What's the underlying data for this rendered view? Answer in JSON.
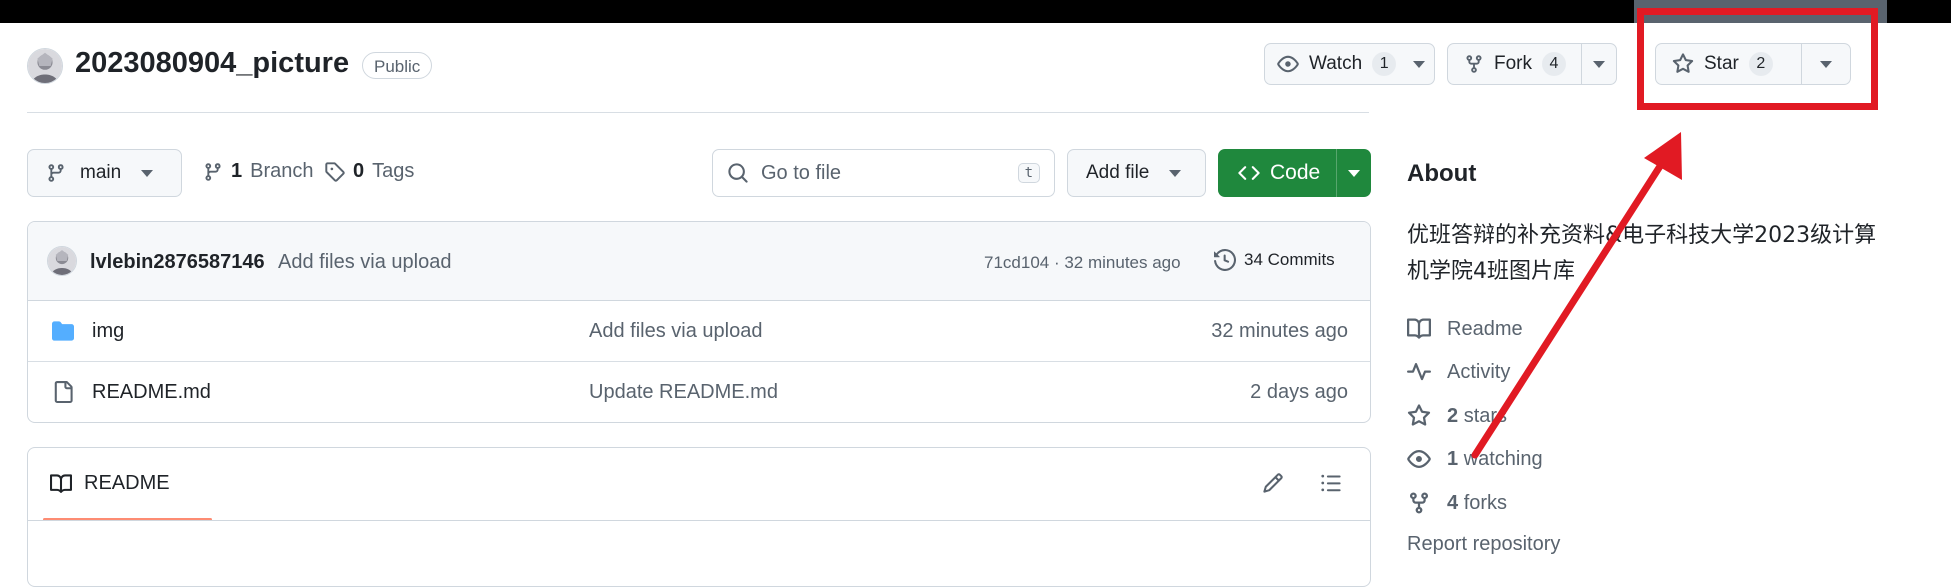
{
  "repo": {
    "name": "2023080904_picture",
    "visibility": "Public"
  },
  "actions": {
    "watch": {
      "label": "Watch",
      "count": "1"
    },
    "fork": {
      "label": "Fork",
      "count": "4"
    },
    "star": {
      "label": "Star",
      "count": "2"
    }
  },
  "toolbar": {
    "branch": "main",
    "branch_count": "1",
    "branch_label": "Branch",
    "tag_count": "0",
    "tag_label": "Tags",
    "search_placeholder": "Go to file",
    "search_shortcut": "t",
    "add_file": "Add file",
    "code": "Code"
  },
  "latest_commit": {
    "author": "lvlebin2876587146",
    "message": "Add files via upload",
    "hash_time": "71cd104 · 32 minutes ago",
    "commits": "34 Commits"
  },
  "files": [
    {
      "name": "img",
      "type": "folder",
      "message": "Add files via upload",
      "time": "32 minutes ago"
    },
    {
      "name": "README.md",
      "type": "file",
      "message": "Update README.md",
      "time": "2 days ago"
    }
  ],
  "readme": {
    "tab": "README"
  },
  "about": {
    "title": "About",
    "description": "优班答辩的补充资料&电子科技大学2023级计算机学院4班图片库",
    "items": [
      {
        "icon": "book-icon",
        "count": "",
        "label": "Readme"
      },
      {
        "icon": "pulse-icon",
        "count": "",
        "label": "Activity"
      },
      {
        "icon": "star-icon",
        "count": "2",
        "label": "stars"
      },
      {
        "icon": "eye-icon",
        "count": "1",
        "label": "watching"
      },
      {
        "icon": "fork-icon",
        "count": "4",
        "label": "forks"
      }
    ],
    "report": "Report repository"
  },
  "colors": {
    "accent_green": "#1f883d",
    "annotation_red": "#e11a23",
    "folder_blue": "#54aeff",
    "muted": "#59636e"
  }
}
